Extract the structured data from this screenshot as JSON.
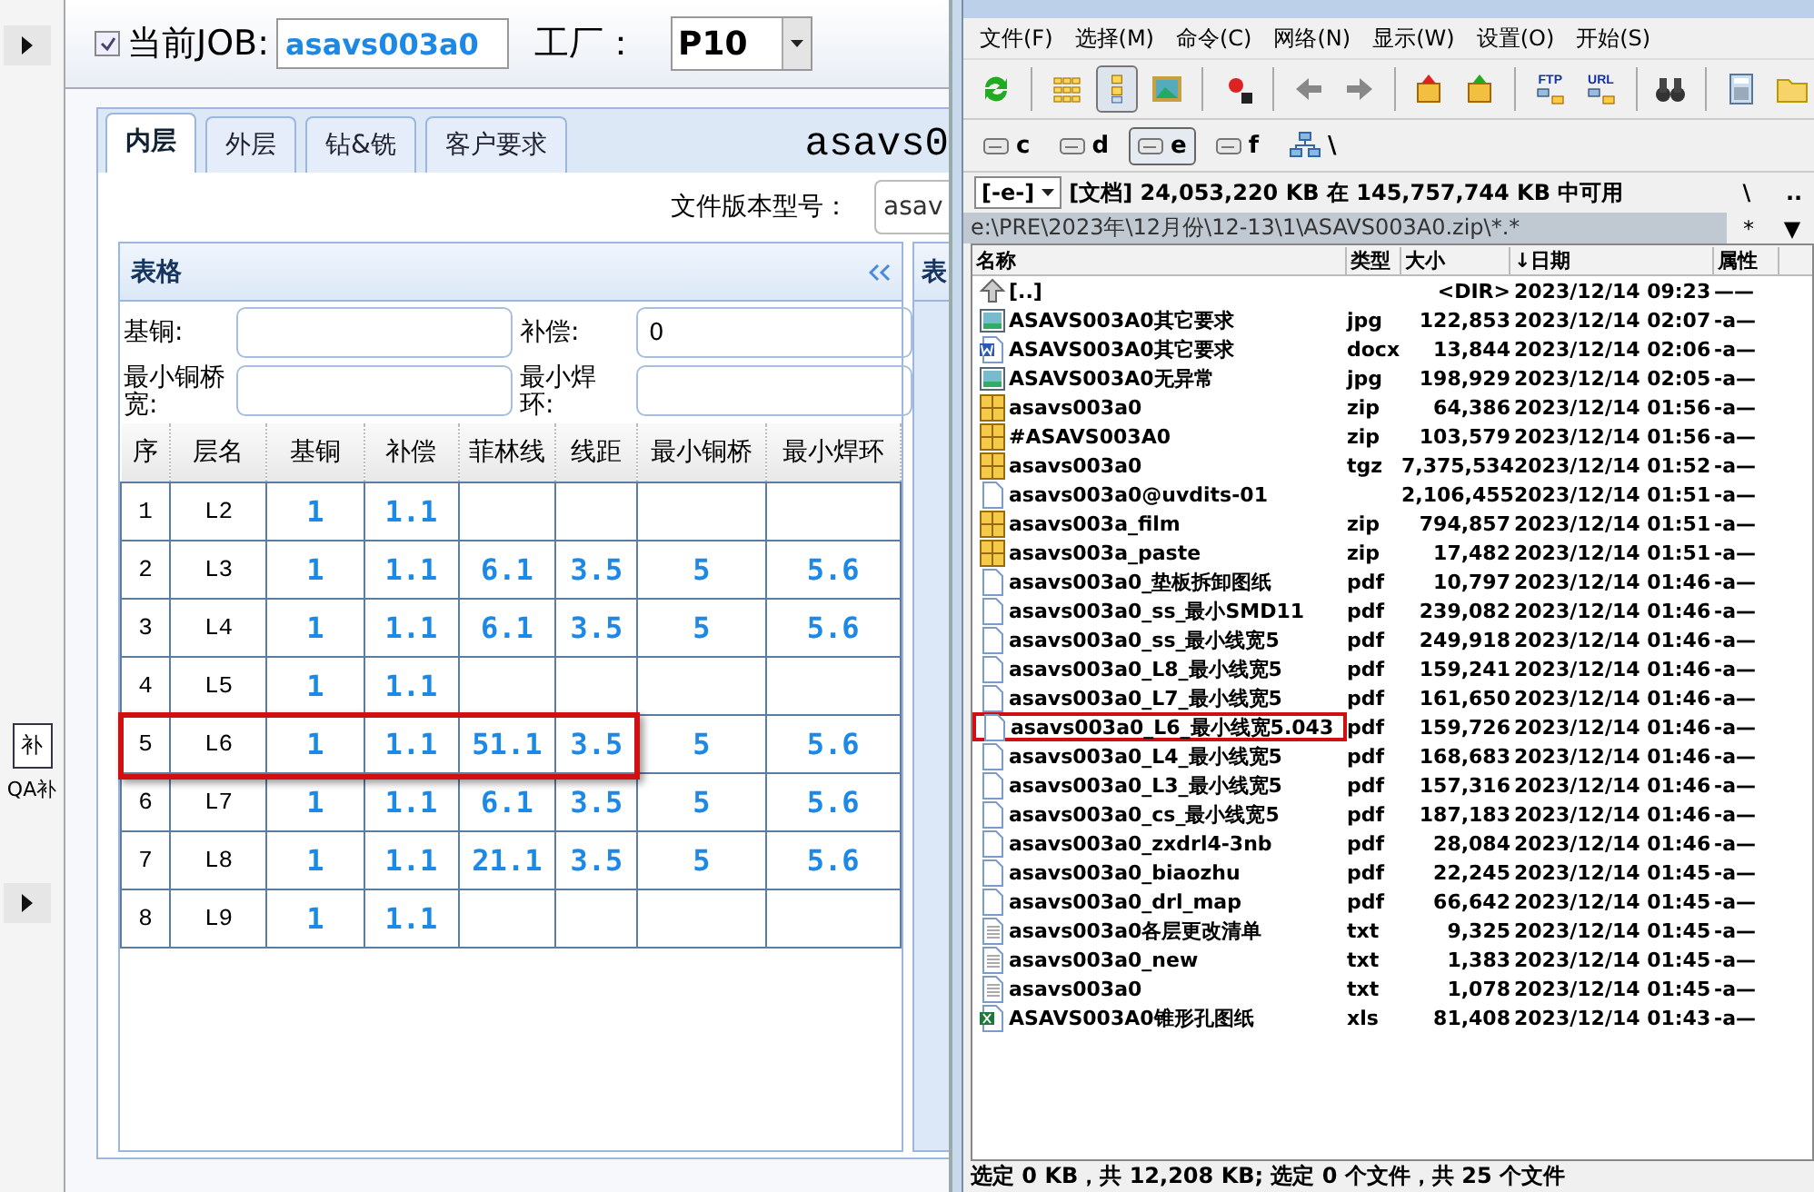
{
  "side_strip": {
    "button": "补",
    "label": "QA补"
  },
  "job_bar": {
    "checked": true,
    "job_label": "当前JOB:",
    "job_value": "asavs003a0",
    "factory_label": "工厂：",
    "factory_value": "P10"
  },
  "tabs": [
    {
      "label": "内层",
      "selected": true
    },
    {
      "label": "外层",
      "selected": false
    },
    {
      "label": "钻&铣",
      "selected": false
    },
    {
      "label": "客户要求",
      "selected": false
    }
  ],
  "heading": "asavs0",
  "version": {
    "label": "文件版本型号：",
    "value": "asav"
  },
  "panel": {
    "title": "表格",
    "fields": [
      {
        "label": "基铜:"
      },
      {
        "label": "补偿:",
        "value": "0"
      },
      {
        "label": "最小铜桥宽:"
      },
      {
        "label": "最小焊环:"
      }
    ]
  },
  "table": {
    "columns": [
      "序",
      "层名",
      "基铜",
      "补偿",
      "菲林线",
      "线距",
      "最小铜桥",
      "最小焊环"
    ],
    "rows": [
      {
        "cells": [
          "1",
          "L2",
          "1",
          "1.1",
          null,
          null,
          null,
          null
        ],
        "highlighted": false
      },
      {
        "cells": [
          "2",
          "L3",
          "1",
          "1.1",
          "6.1",
          "3.5",
          "5",
          "5.6"
        ],
        "highlighted": false
      },
      {
        "cells": [
          "3",
          "L4",
          "1",
          "1.1",
          "6.1",
          "3.5",
          "5",
          "5.6"
        ],
        "highlighted": false
      },
      {
        "cells": [
          "4",
          "L5",
          "1",
          "1.1",
          null,
          null,
          null,
          null
        ],
        "highlighted": false
      },
      {
        "cells": [
          "5",
          "L6",
          "1",
          "1.1",
          "51.1",
          "3.5",
          "5",
          "5.6"
        ],
        "highlighted": true
      },
      {
        "cells": [
          "6",
          "L7",
          "1",
          "1.1",
          "6.1",
          "3.5",
          "5",
          "5.6"
        ],
        "highlighted": false
      },
      {
        "cells": [
          "7",
          "L8",
          "1",
          "1.1",
          "21.1",
          "3.5",
          "5",
          "5.6"
        ],
        "highlighted": false
      },
      {
        "cells": [
          "8",
          "L9",
          "1",
          "1.1",
          null,
          null,
          null,
          null
        ],
        "highlighted": false
      }
    ]
  },
  "side_panel": {
    "title": "表"
  },
  "commander": {
    "menu": [
      "文件(F)",
      "选择(M)",
      "命令(C)",
      "网络(N)",
      "显示(W)",
      "设置(O)",
      "开始(S)"
    ],
    "toolbar": [
      {
        "kind": "refresh",
        "selected": false
      },
      {
        "kind": "separator"
      },
      {
        "kind": "grid",
        "selected": false
      },
      {
        "kind": "list",
        "selected": true
      },
      {
        "kind": "image",
        "selected": false
      },
      {
        "kind": "separator"
      },
      {
        "kind": "star",
        "selected": false
      },
      {
        "kind": "separator"
      },
      {
        "kind": "back",
        "selected": false
      },
      {
        "kind": "forward",
        "selected": false
      },
      {
        "kind": "separator"
      },
      {
        "kind": "pack",
        "selected": false
      },
      {
        "kind": "unpack",
        "selected": false
      },
      {
        "kind": "separator"
      },
      {
        "kind": "ftp",
        "label": "FTP",
        "selected": false
      },
      {
        "kind": "url",
        "label": "URL",
        "selected": false
      },
      {
        "kind": "separator"
      },
      {
        "kind": "binoculars",
        "selected": false
      },
      {
        "kind": "separator"
      },
      {
        "kind": "calculator",
        "selected": false
      },
      {
        "kind": "folder",
        "selected": false
      }
    ],
    "drives": [
      {
        "label": "c",
        "selected": false
      },
      {
        "label": "d",
        "selected": false
      },
      {
        "label": "e",
        "selected": true
      },
      {
        "label": "f",
        "selected": false
      }
    ],
    "network_label": "\\",
    "disk": {
      "drive": "[-e-]",
      "info": "[文档] 24,053,220 KB 在 145,757,744 KB 中可用",
      "root": "\\",
      "up": ".."
    },
    "path": "e:\\PRE\\2023年\\12月份\\12-13\\1\\ASAVS003A0.zip\\*.*",
    "filter": "*",
    "filter_arrow": "▼",
    "columns": [
      "名称",
      "类型",
      "大小",
      "↓日期",
      "属性"
    ],
    "files": [
      {
        "kind": "up",
        "name": "[..]",
        "size": "<DIR>",
        "date": "2023/12/14 09:23",
        "attr": "——",
        "highlighted": false
      },
      {
        "kind": "image",
        "name": "ASAVS003A0其它要求",
        "type": "jpg",
        "size": "122,853",
        "date": "2023/12/14 02:07",
        "attr": "-a—",
        "highlighted": false
      },
      {
        "kind": "word",
        "name": "ASAVS003A0其它要求",
        "type": "docx",
        "size": "13,844",
        "date": "2023/12/14 02:06",
        "attr": "-a—",
        "highlighted": false
      },
      {
        "kind": "image",
        "name": "ASAVS003A0无异常",
        "type": "jpg",
        "size": "198,929",
        "date": "2023/12/14 02:05",
        "attr": "-a—",
        "highlighted": false
      },
      {
        "kind": "archive",
        "name": "asavs003a0",
        "type": "zip",
        "size": "64,386",
        "date": "2023/12/14 01:56",
        "attr": "-a—",
        "highlighted": false
      },
      {
        "kind": "archive",
        "name": "#ASAVS003A0",
        "type": "zip",
        "size": "103,579",
        "date": "2023/12/14 01:56",
        "attr": "-a—",
        "highlighted": false
      },
      {
        "kind": "archive",
        "name": "asavs003a0",
        "type": "tgz",
        "size": "7,375,534",
        "date": "2023/12/14 01:52",
        "attr": "-a—",
        "highlighted": false
      },
      {
        "kind": "file",
        "name": "asavs003a0@uvdits-01",
        "size": "2,106,455",
        "date": "2023/12/14 01:51",
        "attr": "-a—",
        "highlighted": false
      },
      {
        "kind": "archive",
        "name": "asavs003a_film",
        "type": "zip",
        "size": "794,857",
        "date": "2023/12/14 01:51",
        "attr": "-a—",
        "highlighted": false
      },
      {
        "kind": "archive",
        "name": "asavs003a_paste",
        "type": "zip",
        "size": "17,482",
        "date": "2023/12/14 01:51",
        "attr": "-a—",
        "highlighted": false
      },
      {
        "kind": "file",
        "name": "asavs003a0_垫板拆卸图纸",
        "type": "pdf",
        "size": "10,797",
        "date": "2023/12/14 01:46",
        "attr": "-a—",
        "highlighted": false
      },
      {
        "kind": "file",
        "name": "asavs003a0_ss_最小SMD11",
        "type": "pdf",
        "size": "239,082",
        "date": "2023/12/14 01:46",
        "attr": "-a—",
        "highlighted": false
      },
      {
        "kind": "file",
        "name": "asavs003a0_ss_最小线宽5",
        "type": "pdf",
        "size": "249,918",
        "date": "2023/12/14 01:46",
        "attr": "-a—",
        "highlighted": false
      },
      {
        "kind": "file",
        "name": "asavs003a0_L8_最小线宽5",
        "type": "pdf",
        "size": "159,241",
        "date": "2023/12/14 01:46",
        "attr": "-a—",
        "highlighted": false
      },
      {
        "kind": "file",
        "name": "asavs003a0_L7_最小线宽5",
        "type": "pdf",
        "size": "161,650",
        "date": "2023/12/14 01:46",
        "attr": "-a—",
        "highlighted": false
      },
      {
        "kind": "file",
        "name": "asavs003a0_L6_最小线宽5.043",
        "type": "pdf",
        "size": "159,726",
        "date": "2023/12/14 01:46",
        "attr": "-a—",
        "highlighted": true
      },
      {
        "kind": "file",
        "name": "asavs003a0_L4_最小线宽5",
        "type": "pdf",
        "size": "168,683",
        "date": "2023/12/14 01:46",
        "attr": "-a—",
        "highlighted": false
      },
      {
        "kind": "file",
        "name": "asavs003a0_L3_最小线宽5",
        "type": "pdf",
        "size": "157,316",
        "date": "2023/12/14 01:46",
        "attr": "-a—",
        "highlighted": false
      },
      {
        "kind": "file",
        "name": "asavs003a0_cs_最小线宽5",
        "type": "pdf",
        "size": "187,183",
        "date": "2023/12/14 01:46",
        "attr": "-a—",
        "highlighted": false
      },
      {
        "kind": "file",
        "name": "asavs003a0_zxdrl4-3nb",
        "type": "pdf",
        "size": "28,084",
        "date": "2023/12/14 01:46",
        "attr": "-a—",
        "highlighted": false
      },
      {
        "kind": "file",
        "name": "asavs003a0_biaozhu",
        "type": "pdf",
        "size": "22,245",
        "date": "2023/12/14 01:45",
        "attr": "-a—",
        "highlighted": false
      },
      {
        "kind": "file",
        "name": "asavs003a0_drl_map",
        "type": "pdf",
        "size": "66,642",
        "date": "2023/12/14 01:45",
        "attr": "-a—",
        "highlighted": false
      },
      {
        "kind": "text",
        "name": "asavs003a0各层更改清单",
        "type": "txt",
        "size": "9,325",
        "date": "2023/12/14 01:45",
        "attr": "-a—",
        "highlighted": false
      },
      {
        "kind": "text",
        "name": "asavs003a0_new",
        "type": "txt",
        "size": "1,383",
        "date": "2023/12/14 01:45",
        "attr": "-a—",
        "highlighted": false
      },
      {
        "kind": "text",
        "name": "asavs003a0",
        "type": "txt",
        "size": "1,078",
        "date": "2023/12/14 01:45",
        "attr": "-a—",
        "highlighted": false
      },
      {
        "kind": "excel",
        "name": "ASAVS003A0锥形孔图纸",
        "type": "xls",
        "size": "81,408",
        "date": "2023/12/14 01:43",
        "attr": "-a—",
        "highlighted": false
      }
    ],
    "status": "选定 0 KB，共 12,208 KB; 选定 0 个文件，共 25 个文件"
  }
}
